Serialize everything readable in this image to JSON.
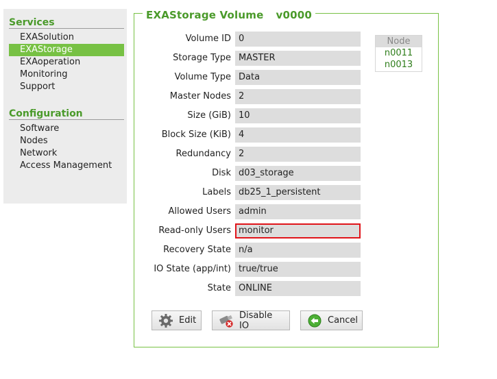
{
  "sidebar": {
    "services_title": "Services",
    "services": [
      {
        "label": "EXASolution",
        "active": false
      },
      {
        "label": "EXAStorage",
        "active": true
      },
      {
        "label": "EXAoperation",
        "active": false
      },
      {
        "label": "Monitoring",
        "active": false
      },
      {
        "label": "Support",
        "active": false
      }
    ],
    "config_title": "Configuration",
    "configuration": [
      {
        "label": "Software"
      },
      {
        "label": "Nodes"
      },
      {
        "label": "Network"
      },
      {
        "label": "Access Management"
      }
    ]
  },
  "panel": {
    "title": "EXAStorage Volume",
    "version": "v0000"
  },
  "fields": [
    {
      "label": "Volume ID",
      "value": "0"
    },
    {
      "label": "Storage Type",
      "value": "MASTER"
    },
    {
      "label": "Volume Type",
      "value": "Data"
    },
    {
      "label": "Master Nodes",
      "value": "2"
    },
    {
      "label": "Size (GiB)",
      "value": "10"
    },
    {
      "label": "Block Size (KiB)",
      "value": "4"
    },
    {
      "label": "Redundancy",
      "value": "2"
    },
    {
      "label": "Disk",
      "value": "d03_storage"
    },
    {
      "label": "Labels",
      "value": "db25_1_persistent"
    },
    {
      "label": "Allowed Users",
      "value": "admin"
    },
    {
      "label": "Read-only Users",
      "value": "monitor",
      "highlighted": true
    },
    {
      "label": "Recovery State",
      "value": "n/a"
    },
    {
      "label": "IO State (app/int)",
      "value": "true/true"
    },
    {
      "label": "State",
      "value": "ONLINE"
    }
  ],
  "nodes": {
    "header": "Node",
    "items": [
      "n0011",
      "n0013"
    ]
  },
  "buttons": {
    "edit": "Edit",
    "disable_io": "Disable IO",
    "cancel": "Cancel"
  },
  "colors": {
    "accent": "#77c144",
    "title_green": "#4a9a2a",
    "highlight_border": "#e0141a",
    "field_bg": "#dddddd"
  },
  "icons": {
    "edit": "gear-icon",
    "disable_io": "usb-disable-icon",
    "cancel": "back-arrow-icon"
  }
}
